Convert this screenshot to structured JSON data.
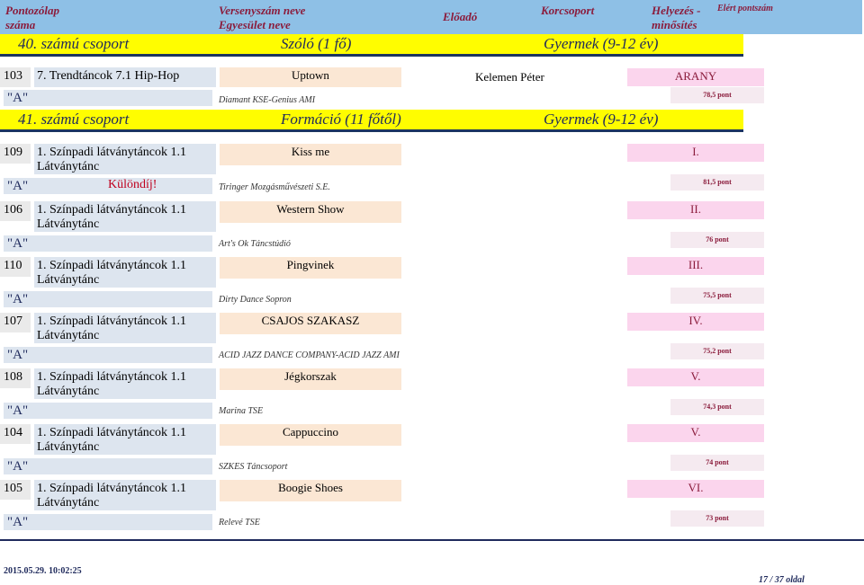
{
  "header": {
    "col_num": "Pontozólap száma",
    "col_name": "Versenyszám neve Egyesület neve",
    "col_performer": "Előadó",
    "col_dance": "Korcsoport",
    "col_place": "Helyezés - minősítés",
    "col_points": "Elért pontszám"
  },
  "groups": [
    {
      "title": "40. számú csoport",
      "form": "Szóló (1 fő)",
      "age": "Gyermek (9-12 év)"
    },
    {
      "title": "41. számú csoport",
      "form": "Formáció (11 főtől)",
      "age": "Gyermek (9-12 év)"
    }
  ],
  "group40_entry": {
    "num": "103",
    "category": "7. Trendtáncok 7.1 Hip-Hop",
    "title": "Uptown",
    "performer": "Kelemen Péter",
    "place": "ARANY",
    "rating": "\"A\"",
    "club": "Diamant KSE-Genius AMI",
    "points": "78,5 pont"
  },
  "entries": [
    {
      "num": "109",
      "cat1": "1. Színpadi látványtáncok 1.1",
      "cat2": "Látványtánc",
      "title": "Kiss me",
      "place": "I.",
      "rating": "\"A\"",
      "special": "Különdíj!",
      "club": "Tiringer Mozgásművészeti S.E.",
      "points": "81,5 pont"
    },
    {
      "num": "106",
      "cat1": "1. Színpadi látványtáncok 1.1",
      "cat2": "Látványtánc",
      "title": "Western Show",
      "place": "II.",
      "rating": "\"A\"",
      "special": "",
      "club": "Art's Ok Táncstúdió",
      "points": "76 pont"
    },
    {
      "num": "110",
      "cat1": "1. Színpadi látványtáncok 1.1",
      "cat2": "Látványtánc",
      "title": "Pingvinek",
      "place": "III.",
      "rating": "\"A\"",
      "special": "",
      "club": "Dirty Dance Sopron",
      "points": "75,5 pont"
    },
    {
      "num": "107",
      "cat1": "1. Színpadi látványtáncok 1.1",
      "cat2": "Látványtánc",
      "title": "CSAJOS SZAKASZ",
      "place": "IV.",
      "rating": "\"A\"",
      "special": "",
      "club": "ACID JAZZ DANCE COMPANY-ACID JAZZ AMI",
      "points": "75,2 pont"
    },
    {
      "num": "108",
      "cat1": "1. Színpadi látványtáncok 1.1",
      "cat2": "Látványtánc",
      "title": "Jégkorszak",
      "place": "V.",
      "rating": "\"A\"",
      "special": "",
      "club": "Marina TSE",
      "points": "74,3 pont"
    },
    {
      "num": "104",
      "cat1": "1. Színpadi látványtáncok 1.1",
      "cat2": "Látványtánc",
      "title": "Cappuccino",
      "place": "V.",
      "rating": "\"A\"",
      "special": "",
      "club": "SZKES Táncsoport",
      "points": "74 pont"
    },
    {
      "num": "105",
      "cat1": "1. Színpadi látványtáncok 1.1",
      "cat2": "Látványtánc",
      "title": "Boogie Shoes",
      "place": "VI.",
      "rating": "\"A\"",
      "special": "",
      "club": "Relevé TSE",
      "points": "73 pont"
    }
  ],
  "footer": {
    "timestamp": "2015.05.29. 10:02:25",
    "page": "17 / 37 oldal"
  }
}
